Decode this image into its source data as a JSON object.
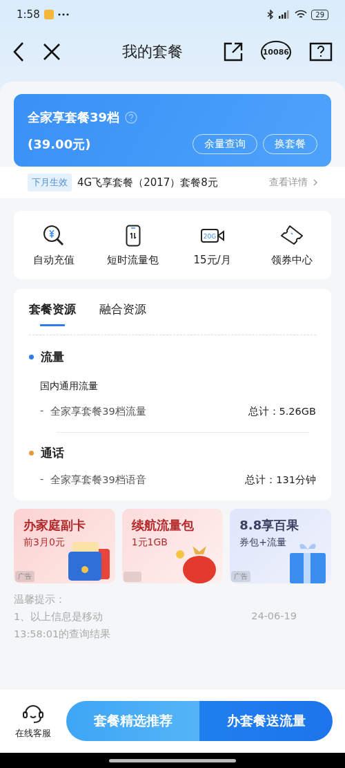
{
  "status_bar": {
    "time": "1:58",
    "battery": "29"
  },
  "nav": {
    "title": "我的套餐",
    "hotline": "10086"
  },
  "plan": {
    "name": "全家享套餐39档",
    "price": "(39.00元)",
    "buttons": [
      "余量查询",
      "换套餐"
    ]
  },
  "next_month": {
    "tag": "下月生效",
    "text": "4G飞享套餐（2017）套餐8元",
    "link": "查看详情"
  },
  "quick_actions": [
    {
      "kind": "search-yuan",
      "label": "自动充值"
    },
    {
      "kind": "phone",
      "label": "短时流量包"
    },
    {
      "kind": "video",
      "label": "15元/月",
      "icon_text": "20G"
    },
    {
      "kind": "ticket",
      "label": "领券中心"
    }
  ],
  "resource_tabs": [
    {
      "label": "套餐资源",
      "selected": true
    },
    {
      "label": "融合资源",
      "selected": false
    }
  ],
  "sections": [
    {
      "title": "流量",
      "color": "#2f7de8",
      "subtitle": "国内通用流量",
      "items": [
        {
          "marker": "-",
          "name": "全家享套餐39档流量",
          "total": "总计：5.26GB"
        }
      ]
    },
    {
      "title": "通话",
      "color": "#e89a3a",
      "items": [
        {
          "marker": "-",
          "name": "全家享套餐39档语音",
          "total": "总计：131分钟"
        }
      ]
    }
  ],
  "promos": [
    {
      "title": "办家庭副卡",
      "subtitle": "前3月0元",
      "kind": "red",
      "ad_label": "广告"
    },
    {
      "title": "续航流量包",
      "subtitle": "1元1GB",
      "kind": "pink"
    },
    {
      "title": "8.8享百果",
      "subtitle": "券包+流量",
      "kind": "blue",
      "ad_label": "广告"
    }
  ],
  "tips": {
    "heading": "温馨提示：",
    "line_1_start": "1、以上信息是移动",
    "line_1_end": "24-06-19",
    "line_2": "13:58:01的查询结果"
  },
  "bottom_bar": {
    "service": "在线客服",
    "buttons": [
      "套餐精选推荐",
      "办套餐送流量"
    ]
  }
}
